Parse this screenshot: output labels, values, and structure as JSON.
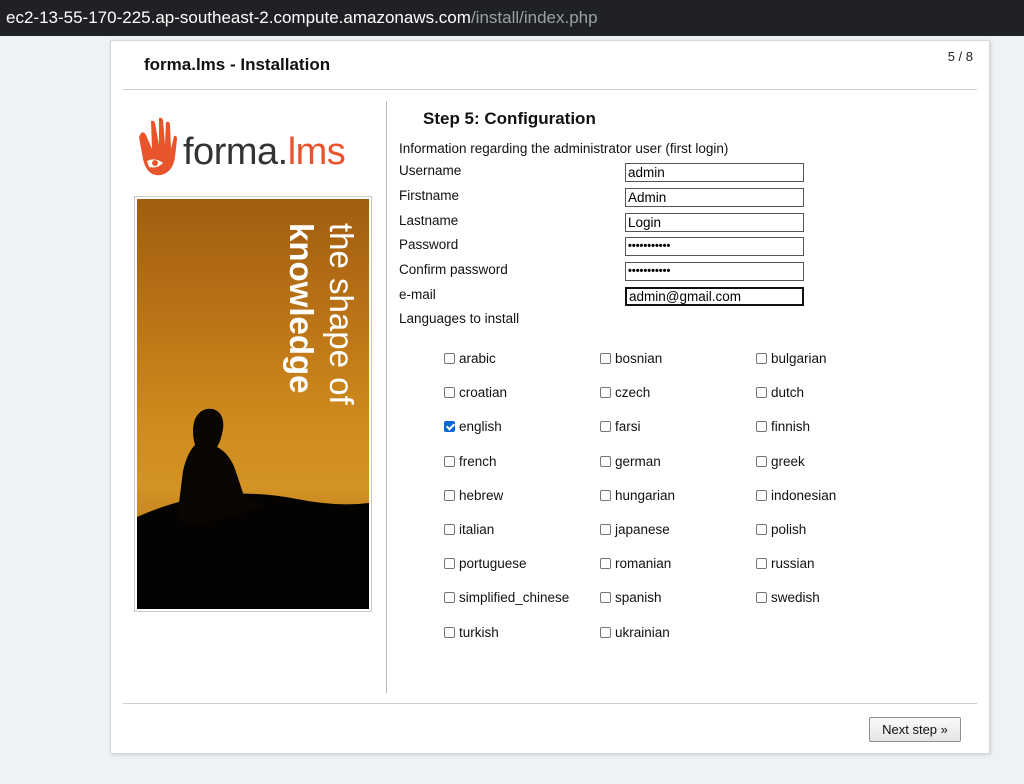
{
  "browser": {
    "url_host": "ec2-13-55-170-225.ap-southeast-2.compute.amazonaws.com",
    "url_path": "/install/index.php"
  },
  "header": {
    "title": "forma.lms - Installation",
    "page_count": "5 / 8"
  },
  "branding": {
    "logo_main": "forma.",
    "logo_accent": "lms",
    "tagline_line1": "the shape of",
    "tagline_line2": "knowledge",
    "accent_color": "#e8542c"
  },
  "step": {
    "title": "Step 5: Configuration",
    "info": "Information regarding the administrator user (first login)"
  },
  "fields": [
    {
      "label": "Username",
      "value": "admin",
      "type": "text"
    },
    {
      "label": "Firstname",
      "value": "Admin",
      "type": "text"
    },
    {
      "label": "Lastname",
      "value": "Login",
      "type": "text"
    },
    {
      "label": "Password",
      "value": "•••••••••••",
      "type": "password"
    },
    {
      "label": "Confirm password",
      "value": "•••••••••••",
      "type": "password"
    },
    {
      "label": "e-mail",
      "value": "admin@gmail.com",
      "type": "text"
    }
  ],
  "languages_heading": "Languages to install",
  "languages": [
    {
      "name": "arabic",
      "checked": false
    },
    {
      "name": "bosnian",
      "checked": false
    },
    {
      "name": "bulgarian",
      "checked": false
    },
    {
      "name": "croatian",
      "checked": false
    },
    {
      "name": "czech",
      "checked": false
    },
    {
      "name": "dutch",
      "checked": false
    },
    {
      "name": "english",
      "checked": true
    },
    {
      "name": "farsi",
      "checked": false
    },
    {
      "name": "finnish",
      "checked": false
    },
    {
      "name": "french",
      "checked": false
    },
    {
      "name": "german",
      "checked": false
    },
    {
      "name": "greek",
      "checked": false
    },
    {
      "name": "hebrew",
      "checked": false
    },
    {
      "name": "hungarian",
      "checked": false
    },
    {
      "name": "indonesian",
      "checked": false
    },
    {
      "name": "italian",
      "checked": false
    },
    {
      "name": "japanese",
      "checked": false
    },
    {
      "name": "polish",
      "checked": false
    },
    {
      "name": "portuguese",
      "checked": false
    },
    {
      "name": "romanian",
      "checked": false
    },
    {
      "name": "russian",
      "checked": false
    },
    {
      "name": "simplified_chinese",
      "checked": false
    },
    {
      "name": "spanish",
      "checked": false
    },
    {
      "name": "swedish",
      "checked": false
    },
    {
      "name": "turkish",
      "checked": false
    },
    {
      "name": "ukrainian",
      "checked": false
    }
  ],
  "buttons": {
    "next_label": "Next step »"
  }
}
